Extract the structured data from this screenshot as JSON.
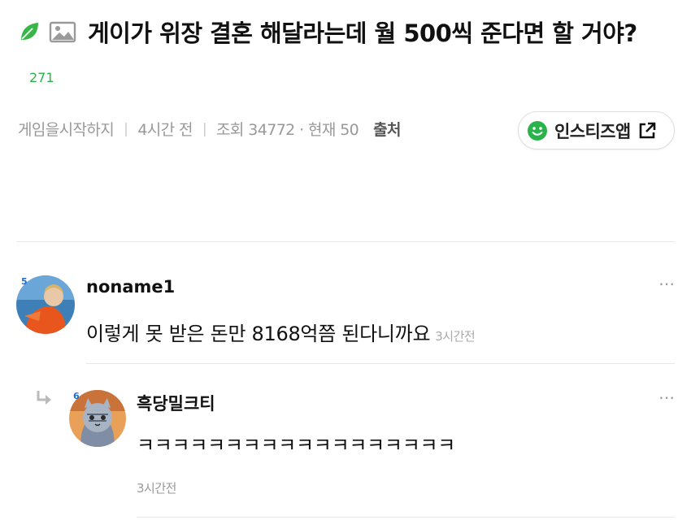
{
  "post": {
    "title": "게이가 위장 결혼 해달라는데 월 500씩 준다면 할 거야?",
    "vote_count": "271",
    "author": "게임을시작하지",
    "time": "4시간 전",
    "views": "조회 34772 · 현재 50",
    "source_label": "출처",
    "app_button_label": "인스티즈앱"
  },
  "comments": [
    {
      "author": "noname1",
      "level": "5",
      "body": "이렇게 못 받은 돈만 8168억쯤 된다니까요",
      "time": "3시간전"
    }
  ],
  "replies": [
    {
      "author": "흑당밀크티",
      "level": "6",
      "body": "ㅋㅋㅋㅋㅋㅋㅋㅋㅋㅋㅋㅋㅋㅋㅋㅋㅋㅋ",
      "time": "3시간전"
    }
  ],
  "icons": {
    "leaf": "leaf-icon",
    "image": "image-icon",
    "smile": "smile-icon",
    "external": "external-link-icon",
    "more": "more-icon",
    "reply": "reply-arrow-icon"
  },
  "colors": {
    "accent_green": "#2ab34a",
    "level_blue": "#1e6fd9",
    "meta_gray": "#999999"
  }
}
